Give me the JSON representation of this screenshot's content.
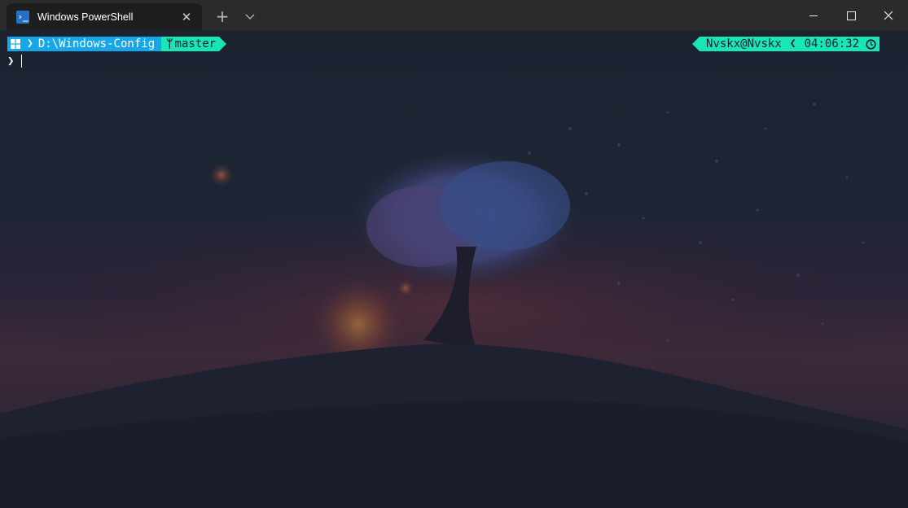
{
  "window": {
    "tab_title": "Windows PowerShell",
    "tab_icon": "powershell-icon",
    "tab_icon_glyph": "›_",
    "close_tab_glyph": "✕",
    "new_tab_glyph": "+",
    "controls": [
      "minimize-icon",
      "maximize-icon",
      "close-icon"
    ]
  },
  "prompt": {
    "os_icon": "windows-logo-icon",
    "path": "D:\\Windows-Config",
    "separator_glyph": "❯",
    "git_icon": "git-branch-icon",
    "git_glyph": "ᛘ",
    "git_branch": "master",
    "user_host": "Nvskx@Nvskx",
    "right_separator_glyph": "❮",
    "time": "04:06:32",
    "time_icon": "clock-icon",
    "prompt_char": "❯"
  },
  "colors": {
    "path_segment": "#15a7e8",
    "git_segment": "#18e6b4",
    "titlebar": "#2b2b2b",
    "terminal_bg": "#1c2230"
  }
}
